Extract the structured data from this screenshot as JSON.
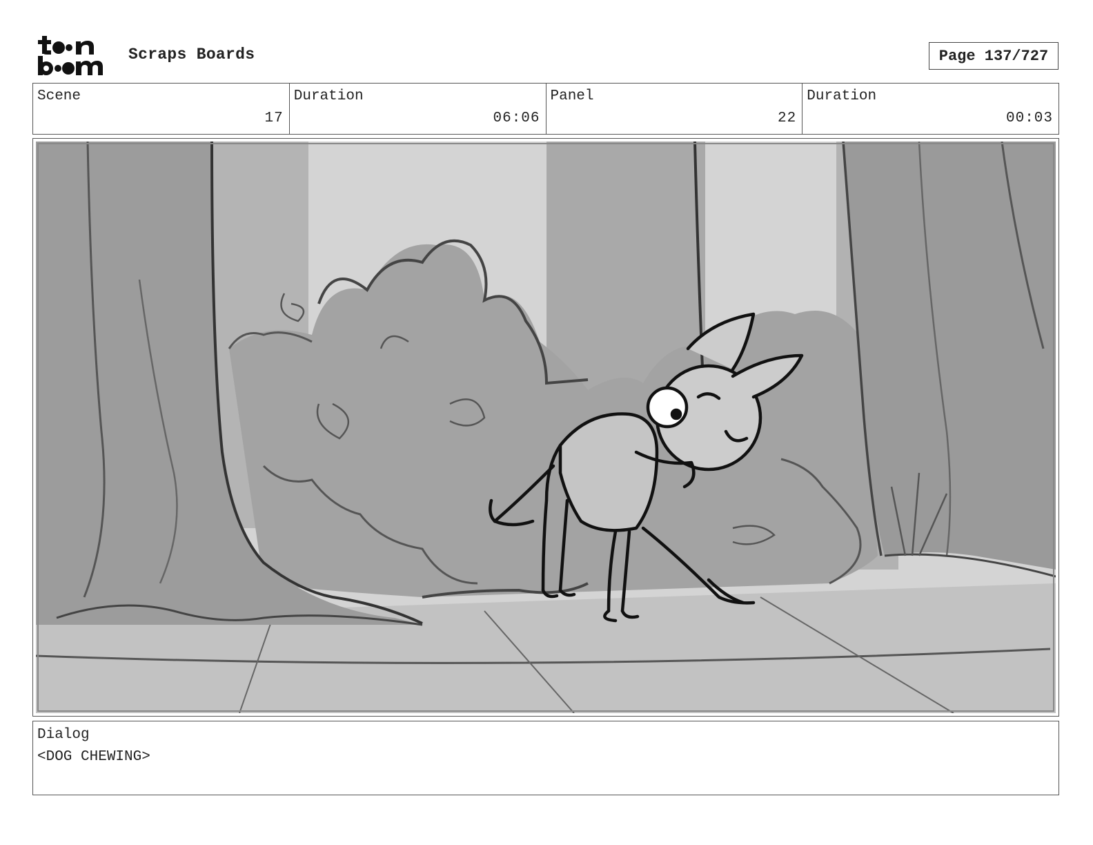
{
  "header": {
    "logo_text": "toon boom",
    "title": "Scraps Boards",
    "page_indicator": "Page 137/727"
  },
  "info": {
    "scene_label": "Scene",
    "scene_value": "17",
    "scene_duration_label": "Duration",
    "scene_duration_value": "06:06",
    "panel_label": "Panel",
    "panel_value": "22",
    "panel_duration_label": "Duration",
    "panel_duration_value": "00:03"
  },
  "dialog": {
    "label": "Dialog",
    "text": "<DOG CHEWING>"
  }
}
